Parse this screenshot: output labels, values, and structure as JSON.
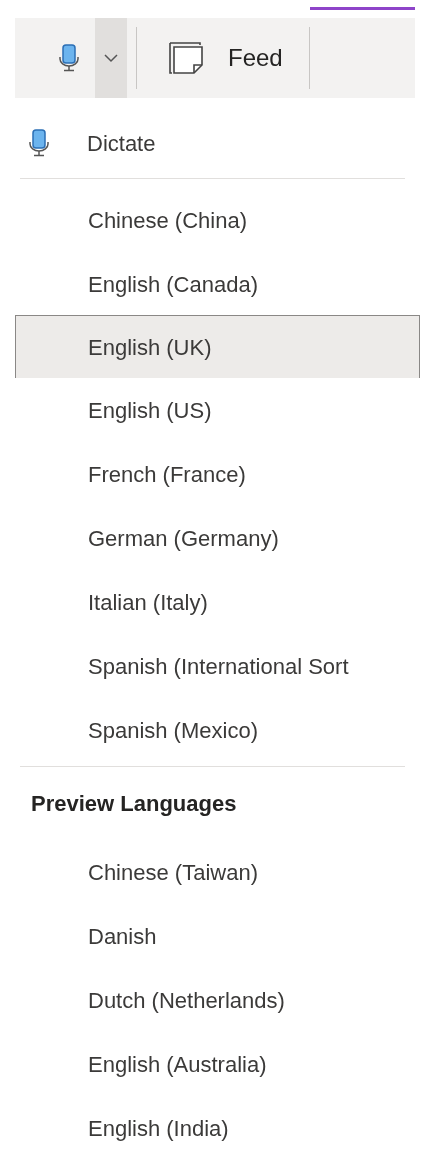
{
  "toolbar": {
    "dictate_dropdown": {
      "expanded": true
    },
    "feed_button": {
      "label": "Feed"
    }
  },
  "menu": {
    "dictate": {
      "label": "Dictate"
    },
    "languages": [
      {
        "label": "Chinese (China)",
        "selected": false
      },
      {
        "label": "English (Canada)",
        "selected": false
      },
      {
        "label": "English (UK)",
        "selected": true
      },
      {
        "label": "English (US)",
        "selected": false
      },
      {
        "label": "French (France)",
        "selected": false
      },
      {
        "label": "German (Germany)",
        "selected": false
      },
      {
        "label": "Italian (Italy)",
        "selected": false
      },
      {
        "label": "Spanish (International Sort",
        "selected": false
      },
      {
        "label": "Spanish (Mexico)",
        "selected": false
      }
    ],
    "preview": {
      "heading": "Preview Languages",
      "languages": [
        {
          "label": "Chinese (Taiwan)",
          "selected": false
        },
        {
          "label": "Danish",
          "selected": false
        },
        {
          "label": "Dutch (Netherlands)",
          "selected": false
        },
        {
          "label": "English (Australia)",
          "selected": false
        },
        {
          "label": "English (India)",
          "selected": false
        }
      ]
    }
  }
}
